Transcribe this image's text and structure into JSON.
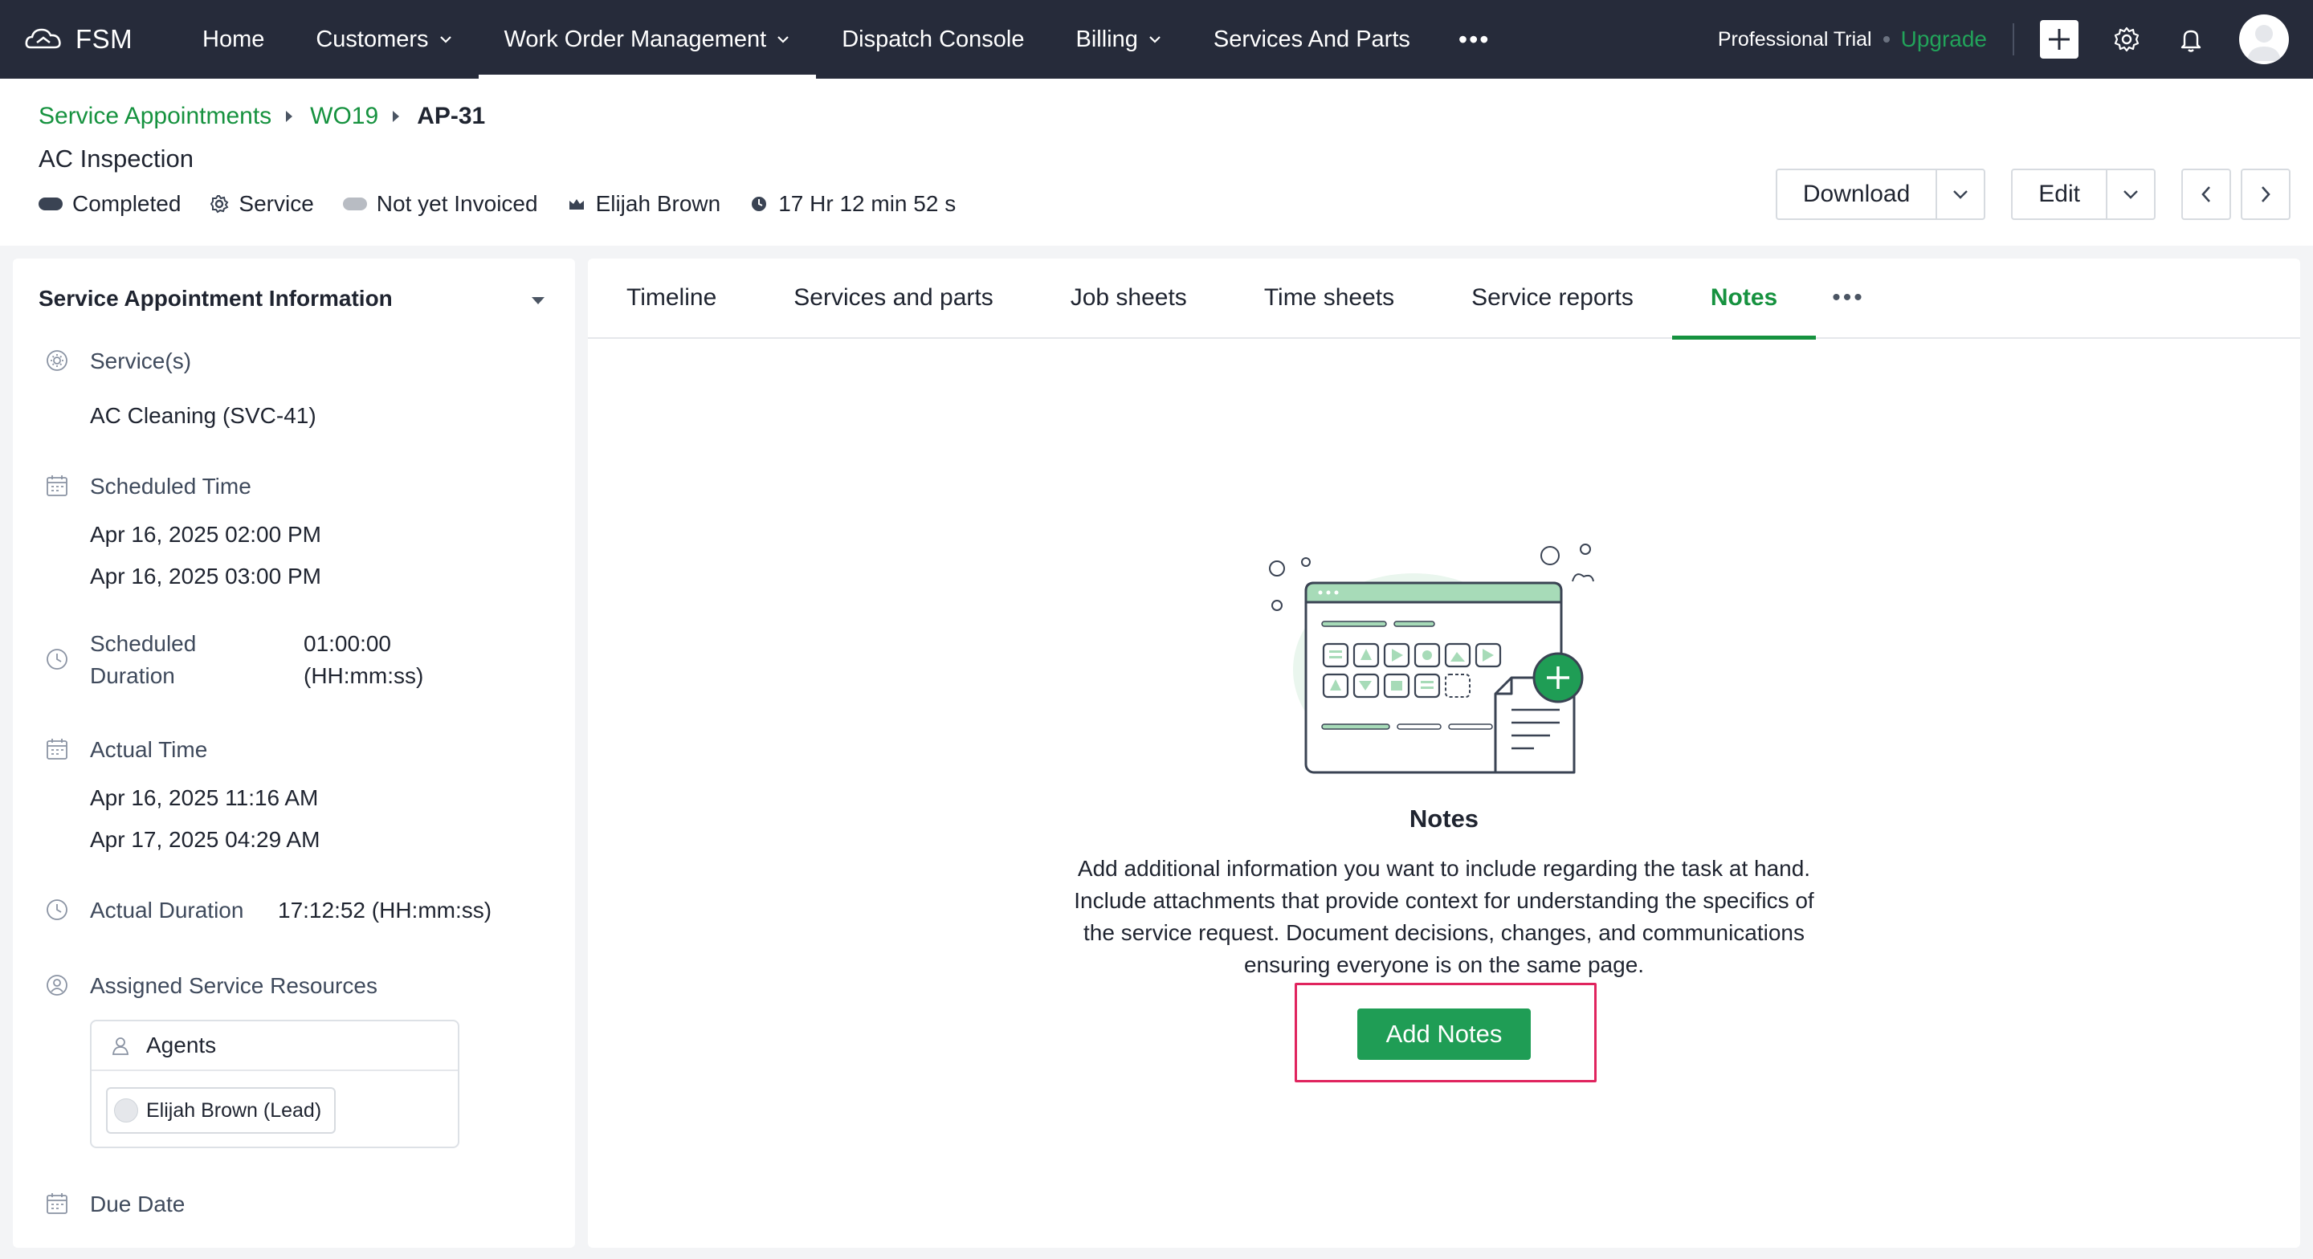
{
  "app": {
    "brand": "FSM"
  },
  "nav": {
    "items": [
      {
        "label": "Home",
        "dropdown": false,
        "active": false
      },
      {
        "label": "Customers",
        "dropdown": true,
        "active": false
      },
      {
        "label": "Work Order Management",
        "dropdown": true,
        "active": true
      },
      {
        "label": "Dispatch Console",
        "dropdown": false,
        "active": false
      },
      {
        "label": "Billing",
        "dropdown": true,
        "active": false
      },
      {
        "label": "Services And Parts",
        "dropdown": false,
        "active": false
      }
    ],
    "more": "•••",
    "trial": "Professional Trial",
    "upgrade": "Upgrade"
  },
  "breadcrumb": {
    "items": [
      "Service Appointments",
      "WO19"
    ],
    "current": "AP-31"
  },
  "record": {
    "title": "AC Inspection",
    "status": "Completed",
    "type": "Service",
    "invoice": "Not yet Invoiced",
    "owner": "Elijah Brown",
    "elapsed": "17 Hr 12 min 52 s"
  },
  "actions": {
    "download": "Download",
    "edit": "Edit"
  },
  "info": {
    "title": "Service Appointment Information",
    "services_label": "Service(s)",
    "services_value": "AC Cleaning (SVC-41)",
    "scheduled_time_label": "Scheduled Time",
    "scheduled_start": "Apr 16, 2025 02:00 PM",
    "scheduled_end": "Apr 16, 2025 03:00 PM",
    "scheduled_duration_label_1": "Scheduled",
    "scheduled_duration_label_2": "Duration",
    "scheduled_duration_value_1": "01:00:00",
    "scheduled_duration_value_2": "(HH:mm:ss)",
    "actual_time_label": "Actual Time",
    "actual_start": "Apr 16, 2025 11:16 AM",
    "actual_end": "Apr 17, 2025 04:29 AM",
    "actual_duration_label": "Actual Duration",
    "actual_duration_value": "17:12:52 (HH:mm:ss)",
    "resources_label": "Assigned Service Resources",
    "agents_label": "Agents",
    "agent_chip": "Elijah Brown (Lead)",
    "due_date_label": "Due Date"
  },
  "tabs": {
    "items": [
      {
        "label": "Timeline",
        "active": false
      },
      {
        "label": "Services and parts",
        "active": false
      },
      {
        "label": "Job sheets",
        "active": false
      },
      {
        "label": "Time sheets",
        "active": false
      },
      {
        "label": "Service reports",
        "active": false
      },
      {
        "label": "Notes",
        "active": true
      }
    ],
    "more": "•••"
  },
  "notes_empty": {
    "title": "Notes",
    "line1": "Add additional information you want to include regarding the task at hand.",
    "line2": "Include attachments that provide context for understanding the specifics of",
    "line3": "the service request. Document decisions, changes, and communications",
    "line4": "ensuring everyone is on the same page.",
    "button": "Add Notes"
  },
  "colors": {
    "nav_bg": "#262b3a",
    "accent_green": "#16923f",
    "button_green": "#1f9d55",
    "highlight": "#e0245e",
    "status_completed": "#3a4353",
    "invoice_grey": "#b8bcc3"
  }
}
